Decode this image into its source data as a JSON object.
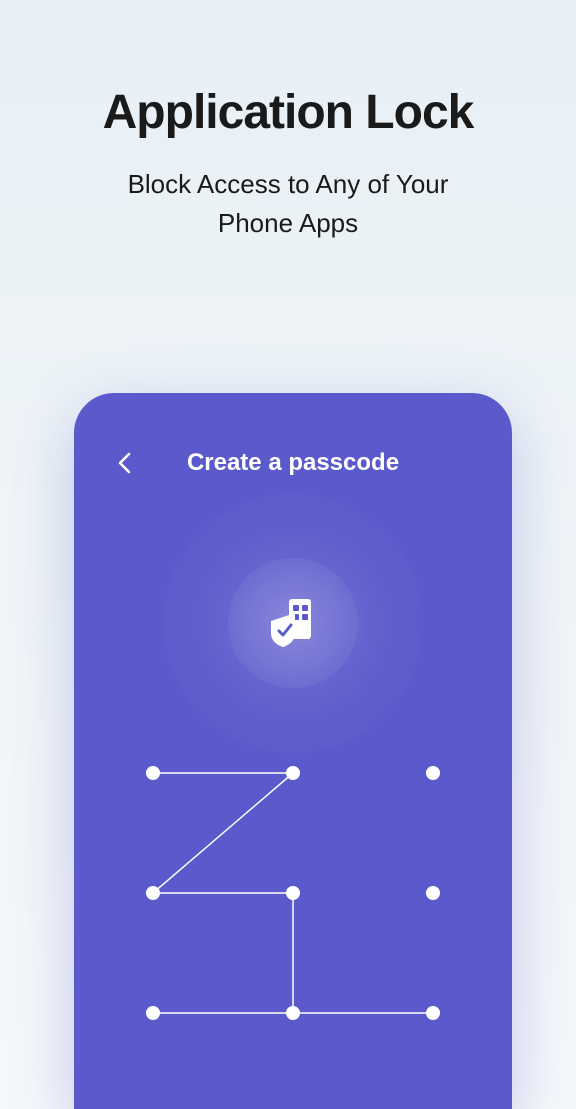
{
  "marketing": {
    "title": "Application Lock",
    "subtitle_line1": "Block Access to Any of Your",
    "subtitle_line2": "Phone Apps"
  },
  "screen": {
    "title": "Create a passcode",
    "back_icon": "chevron-left",
    "center_icon": "shield-apps",
    "pattern": {
      "dots": [
        1,
        2,
        3,
        4,
        5,
        6,
        7,
        8,
        9
      ],
      "connected_path": [
        1,
        2,
        4,
        5,
        8,
        7,
        9
      ]
    }
  },
  "colors": {
    "accent": "#5a5acc",
    "background": "#e8f0f5",
    "text_dark": "#1a1a1a",
    "text_light": "#ffffff"
  }
}
